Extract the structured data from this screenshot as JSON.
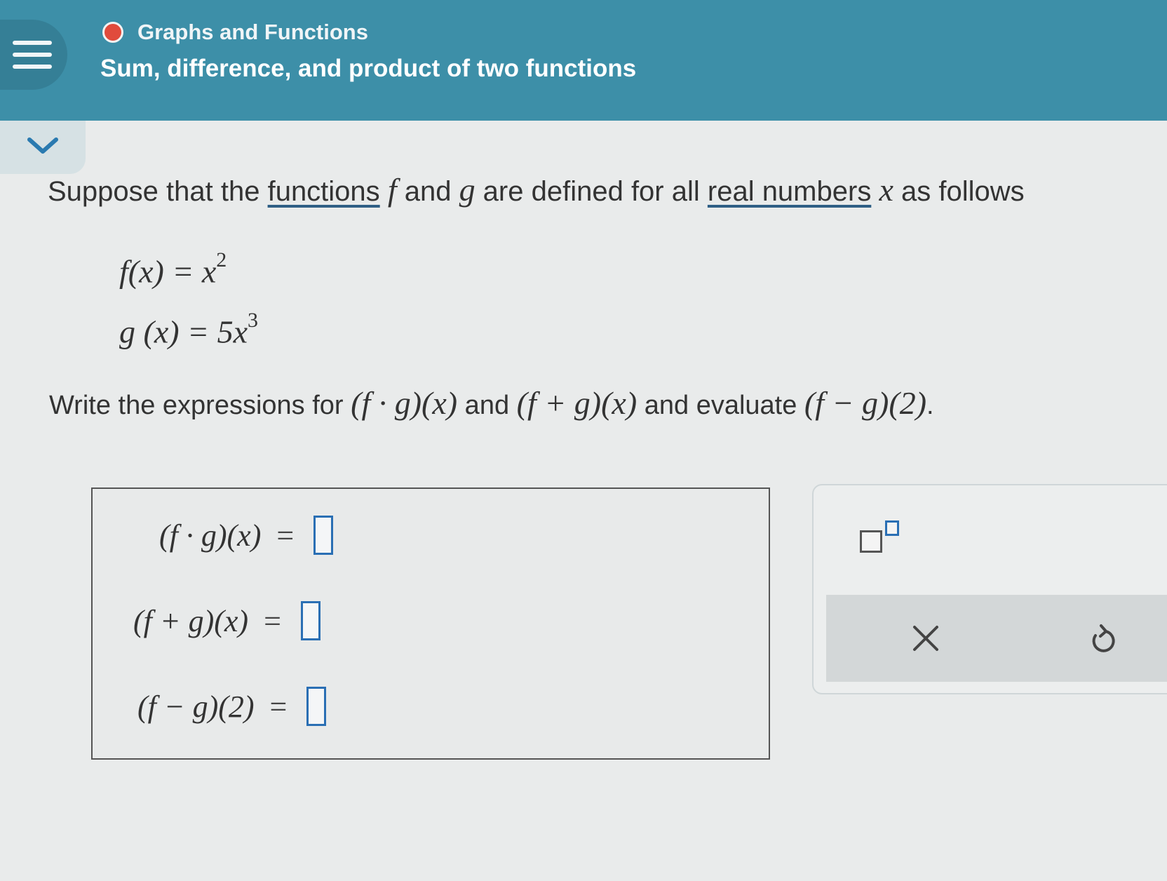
{
  "header": {
    "topic": "Graphs and Functions",
    "title": "Sum, difference, and product of two functions"
  },
  "prompt": {
    "intro": "Suppose that the ",
    "link_functions": "functions",
    "var_f": "f",
    "and1": " and ",
    "var_g": "g",
    "mid": " are defined for all ",
    "link_real_numbers": "real numbers",
    "var_x": "x",
    "end": " as follows"
  },
  "definitions": {
    "f_lhs": "f(x) = x",
    "f_exp": "2",
    "g_lhs": "g (x) = 5x",
    "g_exp": "3"
  },
  "question": {
    "lead": "Write the expressions for ",
    "expr1": "(f · g)(x)",
    "and": " and ",
    "expr2": "(f + g)(x)",
    "mid": " and evaluate ",
    "expr3": "(f − g)(2)",
    "end": "."
  },
  "answers": [
    {
      "label": "(f · g)(x)",
      "eq": "=",
      "value": ""
    },
    {
      "label": "(f + g)(x)",
      "eq": "=",
      "value": ""
    },
    {
      "label": "(f − g)(2)",
      "eq": "=",
      "value": ""
    }
  ],
  "toolbar": {
    "exponent_icon": "exponent-template-icon",
    "clear_icon": "x-icon",
    "undo_icon": "undo-icon"
  },
  "colors": {
    "header_bg": "#3d8fa8",
    "topic_dot": "#e14b3c",
    "input_border": "#2a6fb4"
  }
}
